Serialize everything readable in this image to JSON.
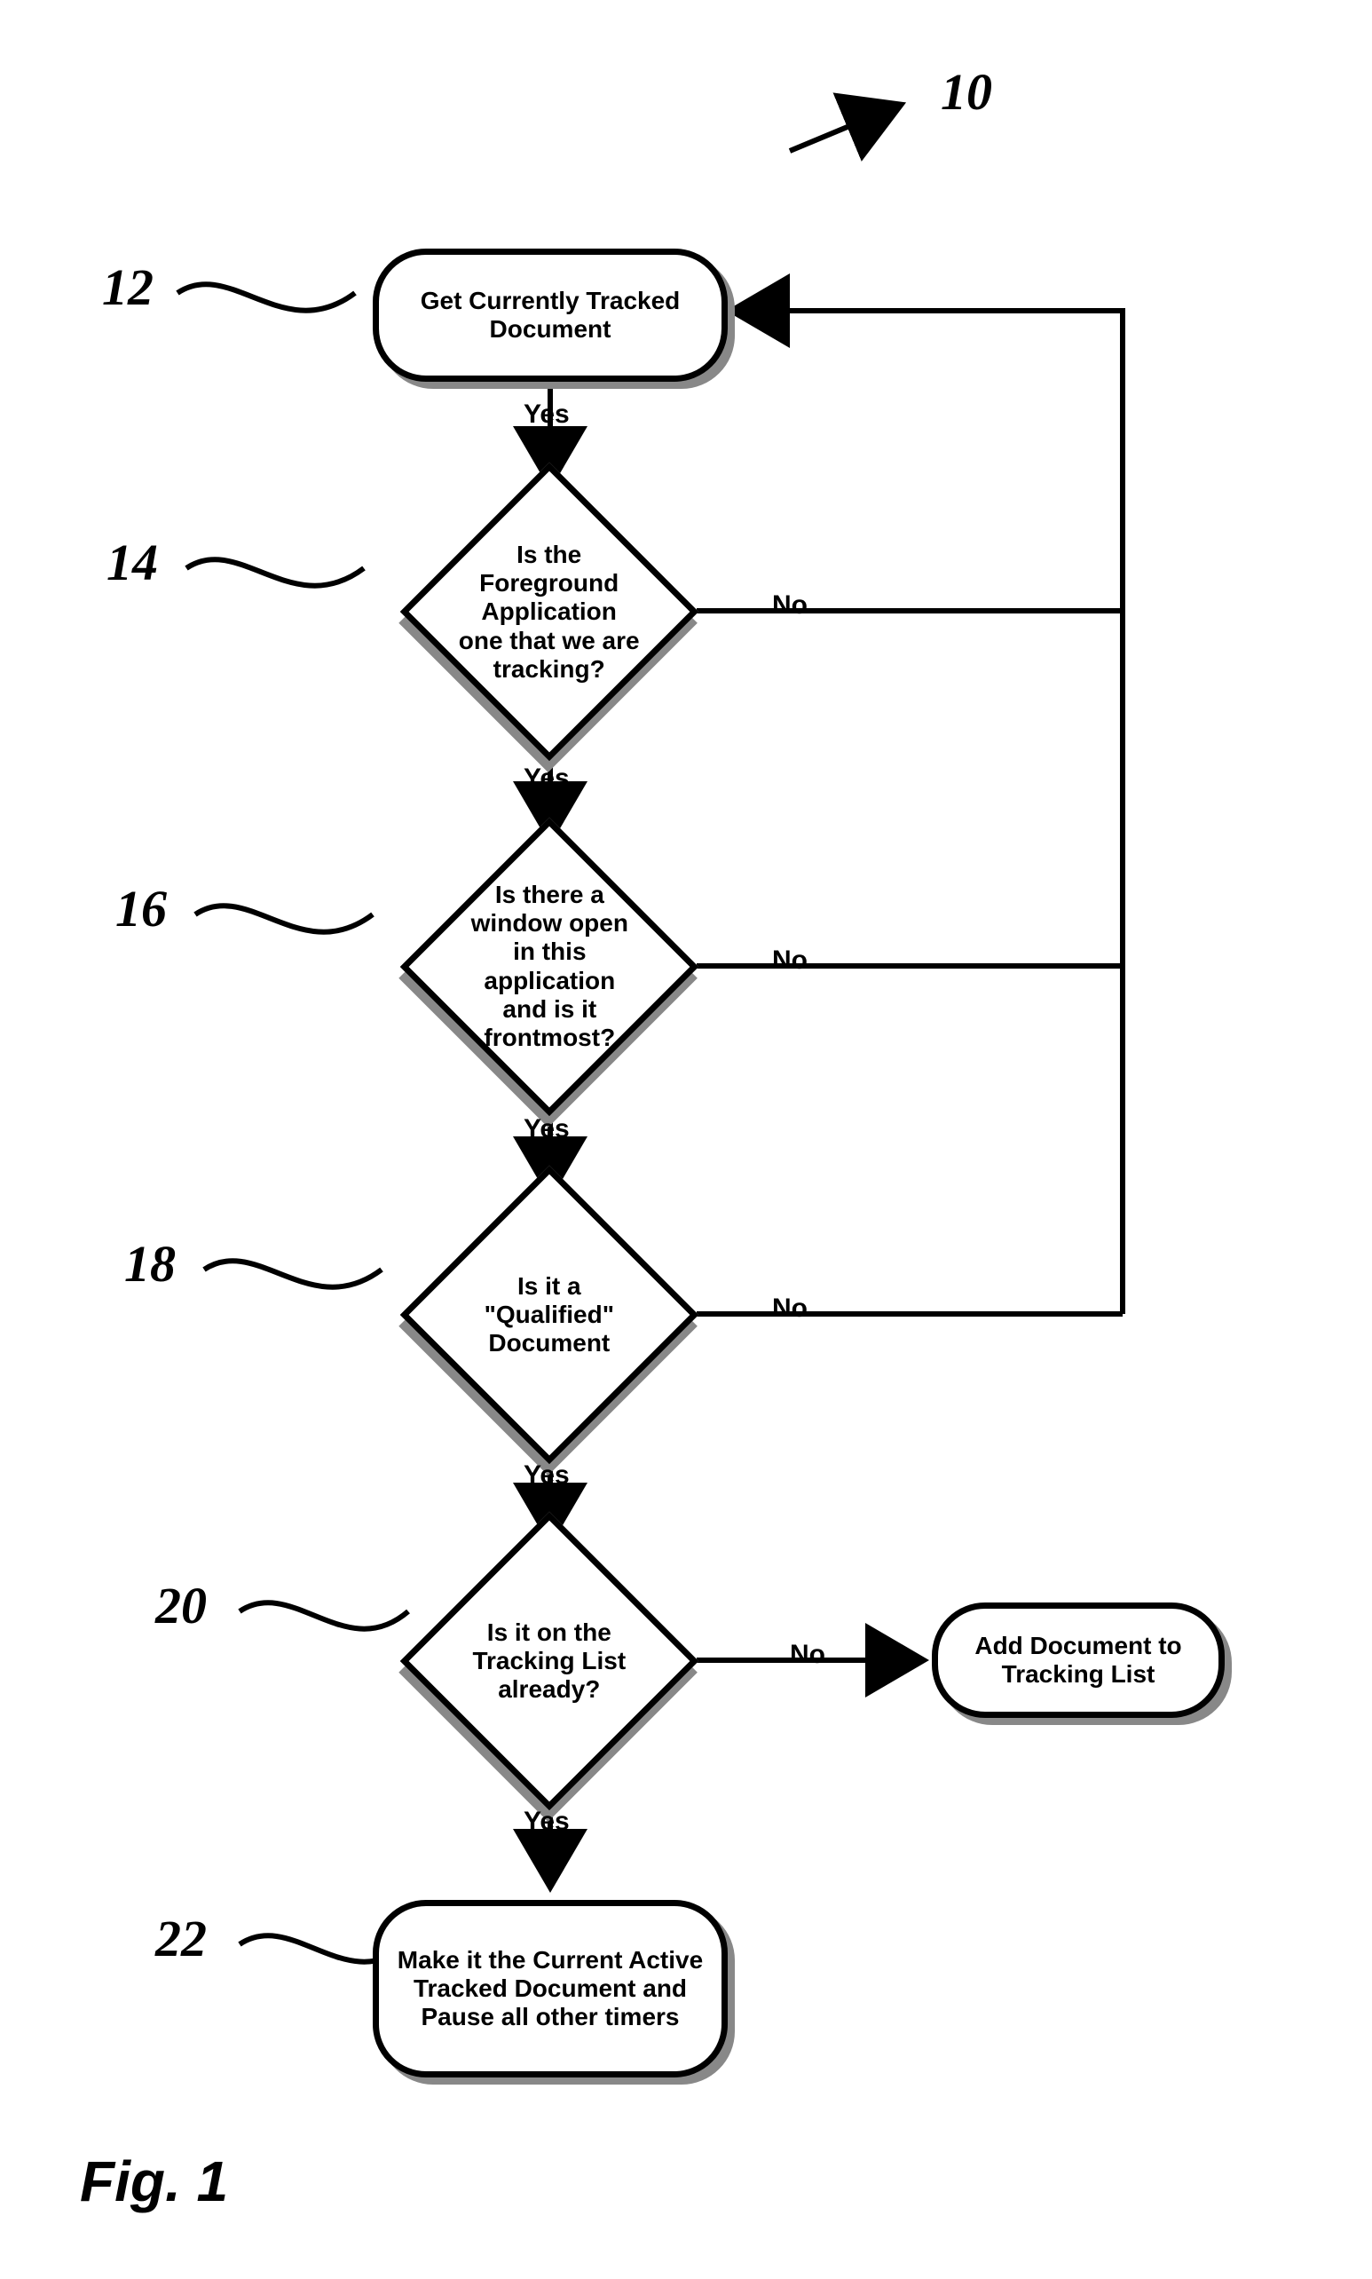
{
  "figure_label": "Fig. 1",
  "diagram_ref": "10",
  "nodes": {
    "n12": {
      "ref": "12",
      "text": "Get Currently Tracked Document"
    },
    "n14": {
      "ref": "14",
      "text": "Is the Foreground Application one that we are tracking?"
    },
    "n16": {
      "ref": "16",
      "text": "Is there a window open in this application and is it frontmost?"
    },
    "n18": {
      "ref": "18",
      "text": "Is it a \"Qualified\" Document"
    },
    "n20": {
      "ref": "20",
      "text": "Is it on the Tracking List already?"
    },
    "n22": {
      "ref": "22",
      "text": "Make it the Current Active Tracked Document and Pause all other timers"
    },
    "nadd": {
      "text": "Add Document to Tracking List"
    }
  },
  "edges": {
    "yes_top": "Yes",
    "yes14": "Yes",
    "yes16": "Yes",
    "yes18": "Yes",
    "yes20": "Yes",
    "no14": "No",
    "no16": "No",
    "no18": "No",
    "no20": "No"
  }
}
